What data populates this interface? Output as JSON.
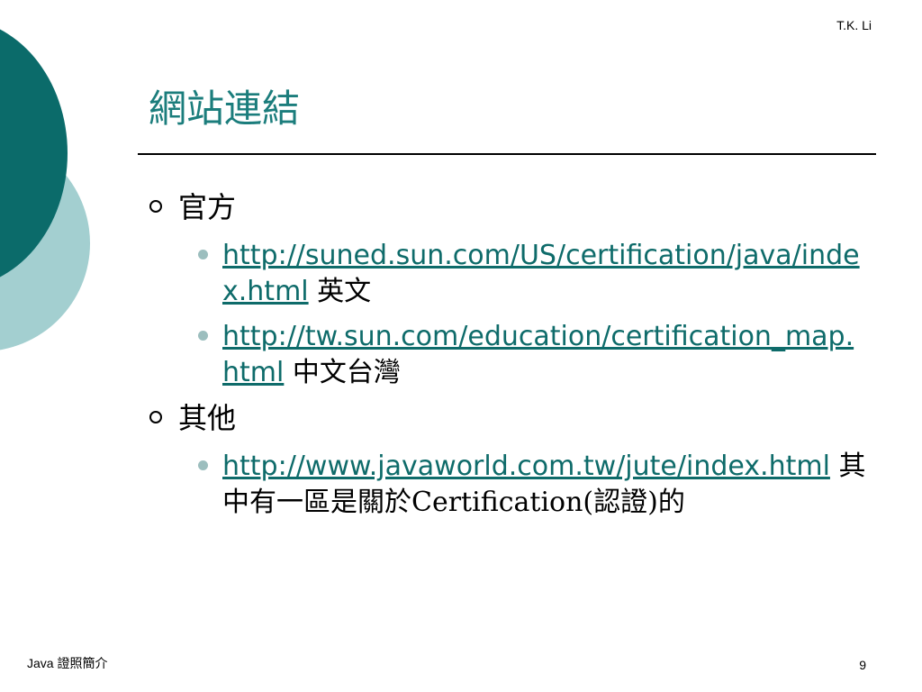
{
  "header": {
    "author": "T.K. Li"
  },
  "title": "網站連結",
  "sections": [
    {
      "label": "官方",
      "items": [
        {
          "url": "http://suned.sun.com/US/certification/java/index.html",
          "note": " 英文"
        },
        {
          "url": "http://tw.sun.com/education/certification_map.html",
          "note": " 中文台灣"
        }
      ]
    },
    {
      "label": "其他",
      "items": [
        {
          "url": "http://www.javaworld.com.tw/jute/index.html",
          "note": " 其中有一區是關於Certification(認證)的"
        }
      ]
    }
  ],
  "footer": {
    "course": "Java 證照簡介",
    "page_number": "9"
  },
  "colors": {
    "title": "#1b7d7c",
    "link": "#0e6b6a",
    "deco_dark": "#0b6b6a",
    "deco_light": "#a3cfd0",
    "sub_bullet": "#9cbebe"
  }
}
